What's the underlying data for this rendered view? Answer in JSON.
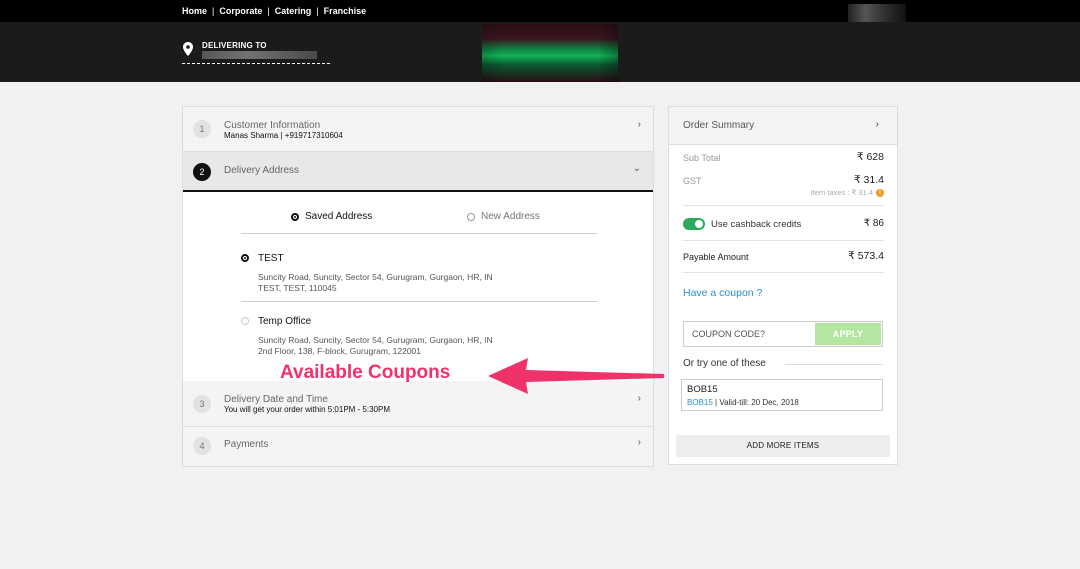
{
  "topnav": {
    "links": [
      "Home",
      "Corporate",
      "Catering",
      "Franchise"
    ],
    "separator": "|"
  },
  "header": {
    "delivering_label": "DELIVERING TO"
  },
  "checkout": {
    "steps": [
      {
        "number": "1",
        "title": "Customer Information",
        "subtitle": "Manas Sharma | +919717310604"
      },
      {
        "number": "2",
        "title": "Delivery Address"
      },
      {
        "number": "3",
        "title": "Delivery Date and Time",
        "subtitle": "You will get your order within 5:01PM - 5:30PM"
      },
      {
        "number": "4",
        "title": "Payments"
      }
    ],
    "address_tabs": {
      "saved": "Saved Address",
      "new": "New Address",
      "selected": "saved"
    },
    "addresses": [
      {
        "name": "TEST",
        "line1": "Suncity Road, Suncity, Sector 54, Gurugram, Gurgaon, HR, IN",
        "line2": "TEST, TEST, 110045",
        "selected": true
      },
      {
        "name": "Temp Office",
        "line1": "Suncity Road, Suncity, Sector 54, Gurugram, Gurgaon, HR, IN",
        "line2": "2nd Floor, 138, F-block, Gurugram, 122001",
        "selected": false
      }
    ]
  },
  "annotation": {
    "text": "Available Coupons",
    "color": "#f0326b"
  },
  "summary": {
    "title": "Order Summary",
    "subtotal_label": "Sub Total",
    "subtotal_value": "₹ 628",
    "gst_label": "GST",
    "gst_value": "₹ 31.4",
    "item_taxes": "Item taxes : ₹ 31.4",
    "cashback_label": "Use cashback credits",
    "cashback_value": "₹ 86",
    "cashback_enabled": true,
    "payable_label": "Payable Amount",
    "payable_value": "₹ 573.4",
    "have_coupon": "Have a coupon ?",
    "coupon_placeholder": "COUPON CODE?",
    "apply_label": "APPLY",
    "try_label": "Or try one of these",
    "coupons": [
      {
        "code": "BOB15",
        "link_code": "BOB15",
        "valid": "| Valid-till: 20 Dec, 2018"
      }
    ],
    "add_more_label": "ADD MORE ITEMS"
  },
  "colors": {
    "accent_link": "#2a8fd4",
    "toggle_on": "#2ea85a",
    "apply_button": "#b5e6a1",
    "info": "#f39a1e"
  }
}
